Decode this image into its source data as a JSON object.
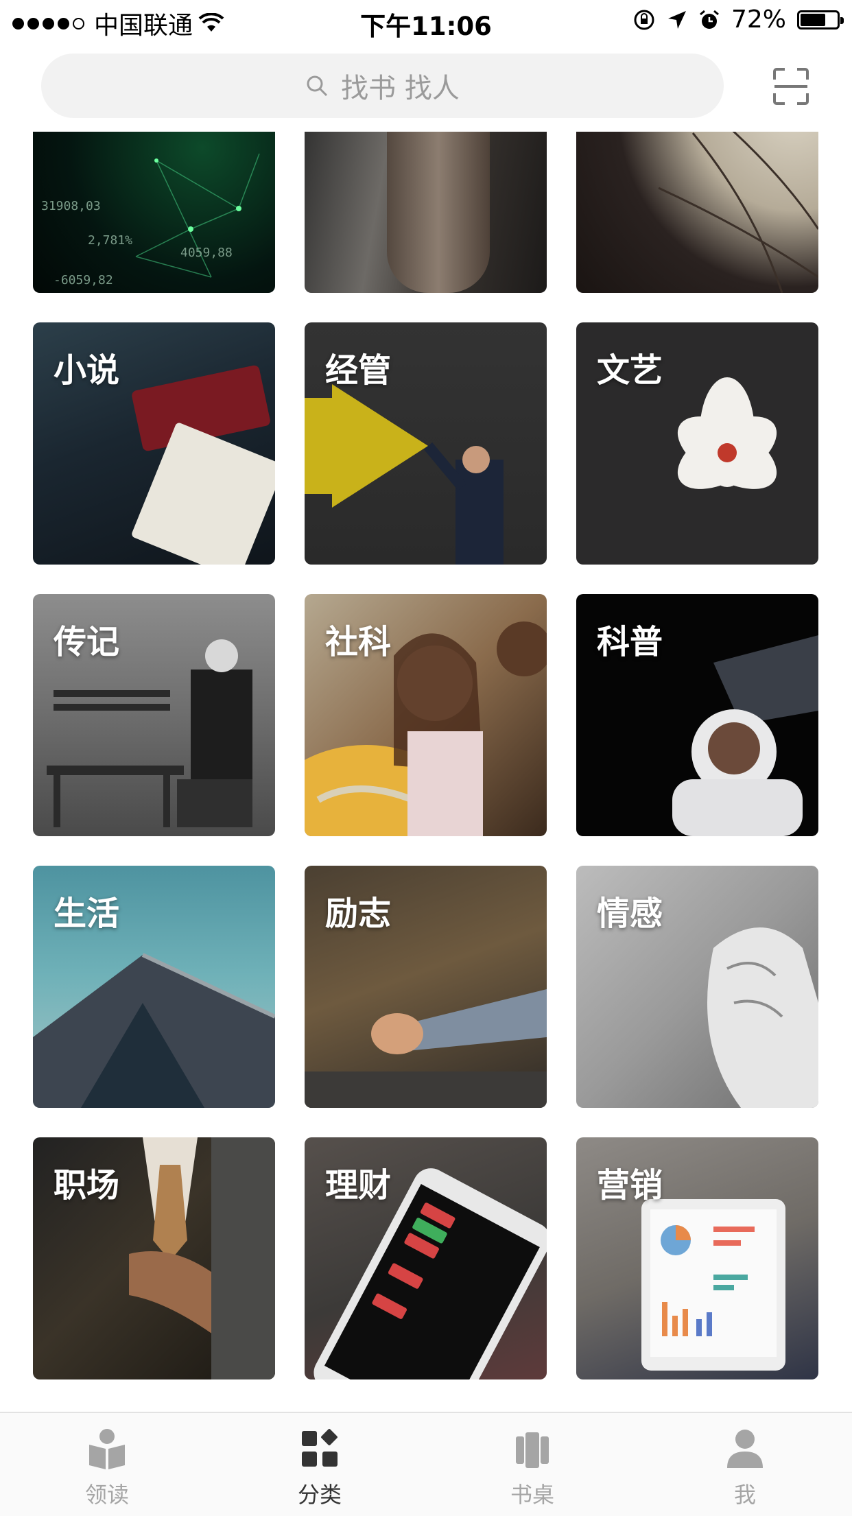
{
  "status_bar": {
    "carrier": "中国联通",
    "time": "下午11:06",
    "battery": "72%",
    "battery_level": 0.72
  },
  "search": {
    "placeholder": "找书 找人",
    "icon": "search-icon",
    "scan_icon": "scan-icon"
  },
  "categories": {
    "top_row_partial": [
      "",
      "",
      ""
    ],
    "items": [
      {
        "label": "小说"
      },
      {
        "label": "经管"
      },
      {
        "label": "文艺"
      },
      {
        "label": "传记"
      },
      {
        "label": "社科"
      },
      {
        "label": "科普"
      },
      {
        "label": "生活"
      },
      {
        "label": "励志"
      },
      {
        "label": "情感"
      },
      {
        "label": "职场"
      },
      {
        "label": "理财"
      },
      {
        "label": "营销"
      }
    ]
  },
  "tabbar": {
    "tabs": [
      {
        "label": "领读",
        "icon": "reading-icon",
        "active": false
      },
      {
        "label": "分类",
        "icon": "category-icon",
        "active": true
      },
      {
        "label": "书桌",
        "icon": "bookshelf-icon",
        "active": false
      },
      {
        "label": "我",
        "icon": "profile-icon",
        "active": false
      }
    ]
  },
  "colors": {
    "active_tab": "#333333",
    "inactive_tab": "#a5a5a5",
    "search_bg": "#f2f2f2"
  }
}
